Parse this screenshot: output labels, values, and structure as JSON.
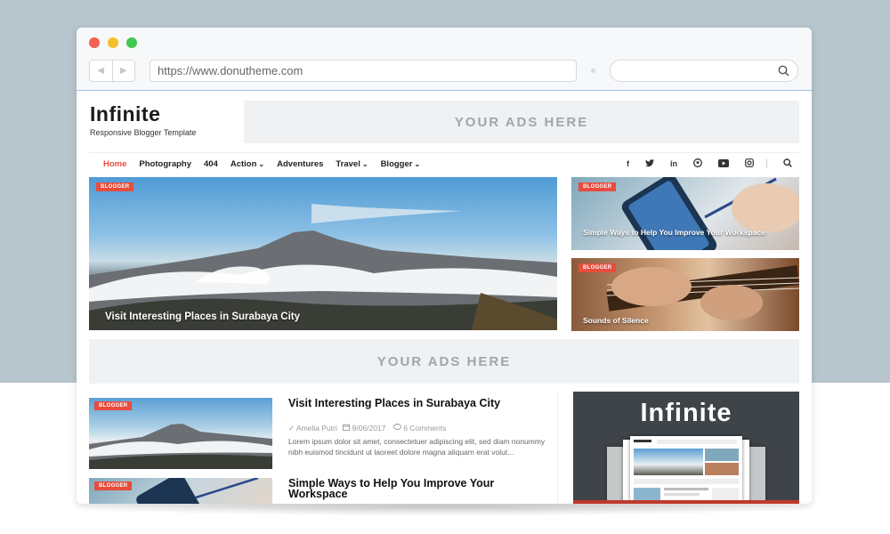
{
  "browser": {
    "url": "https://www.donutheme.com",
    "search_placeholder": "",
    "traffic_lights": {
      "close": "#f25f57",
      "minimize": "#f6bd2f",
      "maximize": "#3fc94f"
    }
  },
  "site": {
    "title": "Infinite",
    "tagline": "Responsive Blogger Template",
    "ads_text": "YOUR ADS HERE",
    "accent_color": "#e74c3c"
  },
  "menu": {
    "items": [
      {
        "label": "Home",
        "active": true,
        "dropdown": false
      },
      {
        "label": "Photography",
        "active": false,
        "dropdown": false
      },
      {
        "label": "404",
        "active": false,
        "dropdown": false
      },
      {
        "label": "Action",
        "active": false,
        "dropdown": true
      },
      {
        "label": "Adventures",
        "active": false,
        "dropdown": false
      },
      {
        "label": "Travel",
        "active": false,
        "dropdown": true
      },
      {
        "label": "Blogger",
        "active": false,
        "dropdown": true
      }
    ],
    "dropdown_glyph": "⌄",
    "social": {
      "facebook": "f",
      "twitter": "🐦",
      "linkedin": "in",
      "pinterest": "℗",
      "youtube": "▶",
      "instagram": "◎"
    }
  },
  "featured": {
    "main": {
      "badge": "BLOGGER",
      "title": "Visit Interesting Places in Surabaya City"
    },
    "side": [
      {
        "badge": "BLOGGER",
        "title": "Simple Ways to Help You Improve Your Workspace"
      },
      {
        "badge": "BLOGGER",
        "title": "Sounds of Silence"
      }
    ]
  },
  "posts": [
    {
      "badge": "BLOGGER",
      "title": "Visit Interesting Places in Surabaya City",
      "author": "Amelia Putri",
      "date": "9/06/2017",
      "comments": "6 Comments",
      "excerpt": "Lorem ipsum dolor sit amet, consectetuer adipiscing elit, sed diam nonummy nibh euismod tincidunt ut laoreet dolore magna aliquam erat volut..."
    },
    {
      "badge": "BLOGGER",
      "title": "Simple Ways to Help You Improve Your Workspace"
    }
  ],
  "promo": {
    "title": "Infinite"
  }
}
